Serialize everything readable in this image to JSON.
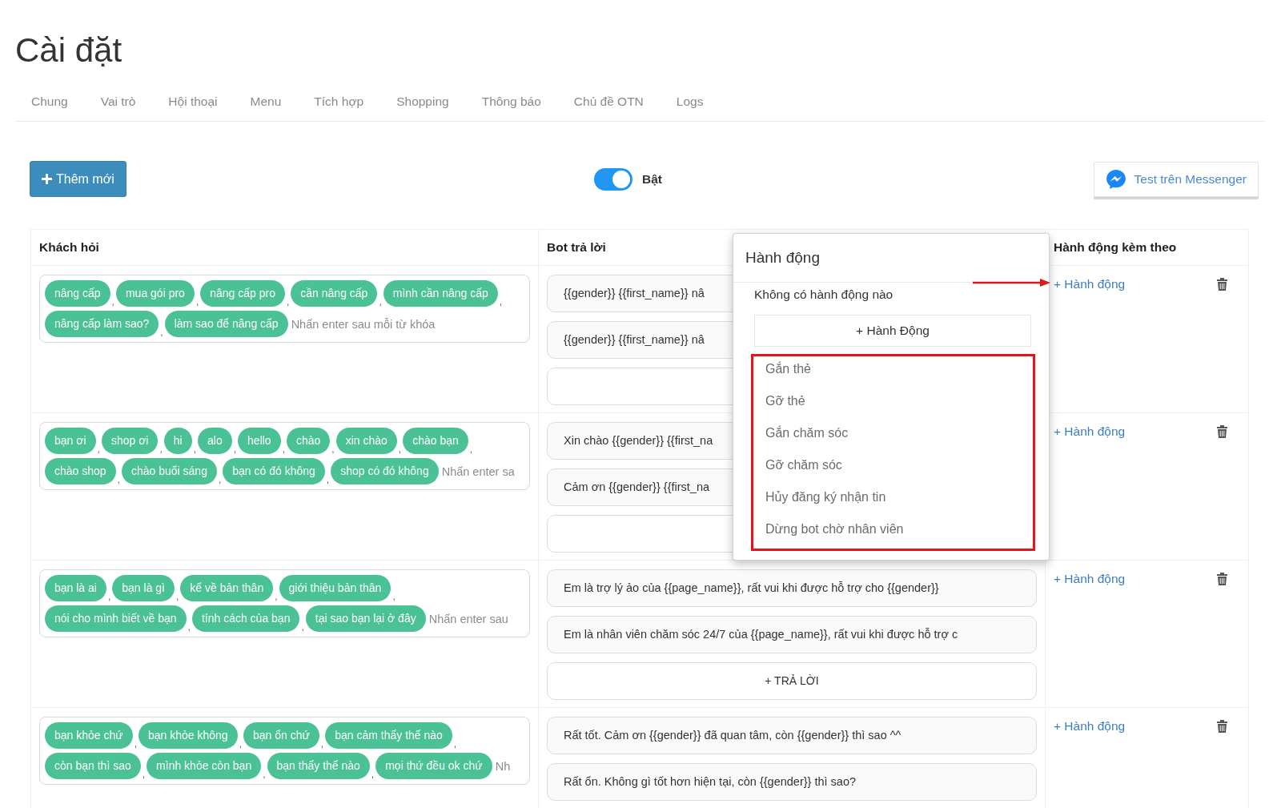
{
  "page": {
    "title": "Cài đặt"
  },
  "tabs": [
    {
      "label": "Chung",
      "selected": false
    },
    {
      "label": "Vai trò",
      "selected": false
    },
    {
      "label": "Hội thoại",
      "selected": false
    },
    {
      "label": "Menu",
      "selected": false
    },
    {
      "label": "Tích hợp",
      "selected": false
    },
    {
      "label": "Shopping",
      "selected": false
    },
    {
      "label": "Thông báo",
      "selected": false
    },
    {
      "label": "Chủ đề OTN",
      "selected": false
    },
    {
      "label": "Logs",
      "selected": false
    }
  ],
  "toolbar": {
    "add_button": "Thêm mới",
    "toggle": {
      "label": "Bật",
      "on": true
    },
    "test_button": "Test trên Messenger"
  },
  "table": {
    "columns": [
      "Khách hỏi",
      "Bot trả lời",
      "Hành động kèm theo"
    ],
    "rows": [
      {
        "keywords": [
          {
            "text": "nâng cấp",
            "separator": ","
          },
          {
            "text": "mua gói pro",
            "separator": ","
          },
          {
            "text": "nâng cấp pro",
            "separator": ","
          },
          {
            "text": "cần nâng cấp",
            "separator": ","
          },
          {
            "text": "mình cần nâng cấp",
            "separator": ","
          },
          {
            "text": "nâng cấp làm sao?",
            "separator": ","
          },
          {
            "text": "làm sao để nâng cấp"
          }
        ],
        "keyword_placeholder": "Nhấn enter sau mỗi từ khóa",
        "replies": [
          {
            "kind": "text",
            "text": "{{gender}} {{first_name}} nâ"
          },
          {
            "kind": "text",
            "text": "{{gender}} {{first_name}} nâ"
          },
          {
            "kind": "add"
          }
        ],
        "action_link": "+ Hành động"
      },
      {
        "keywords": [
          {
            "text": "bạn ơi",
            "separator": ","
          },
          {
            "text": "shop ơi",
            "separator": ","
          },
          {
            "text": "hi",
            "separator": ","
          },
          {
            "text": "alo",
            "separator": ","
          },
          {
            "text": "hello",
            "separator": ","
          },
          {
            "text": "chào",
            "separator": ","
          },
          {
            "text": "xin chào",
            "separator": ","
          },
          {
            "text": "chào bạn",
            "separator": ","
          },
          {
            "text": "chào shop",
            "separator": ","
          },
          {
            "text": "chào buổi sáng",
            "separator": ","
          },
          {
            "text": "bạn có đó không",
            "separator": ","
          },
          {
            "text": "shop có đó không"
          }
        ],
        "keyword_placeholder": "Nhấn enter sa",
        "replies": [
          {
            "kind": "text",
            "text": "Xin chào {{gender}} {{first_na"
          },
          {
            "kind": "text",
            "text": "Cảm ơn {{gender}} {{first_na"
          },
          {
            "kind": "add"
          }
        ],
        "action_link": "+ Hành động"
      },
      {
        "keywords": [
          {
            "text": "bạn là ai",
            "separator": ","
          },
          {
            "text": "bạn là gì",
            "separator": ","
          },
          {
            "text": "kể về bản thân",
            "separator": ","
          },
          {
            "text": "giới thiệu bản thân",
            "separator": ","
          },
          {
            "text": "nói cho mình biết về bạn",
            "separator": ","
          },
          {
            "text": "tính cách của bạn",
            "separator": ","
          },
          {
            "text": "tại sao bạn lại ở đây"
          }
        ],
        "keyword_placeholder": "Nhấn enter sau",
        "replies": [
          {
            "kind": "text",
            "text": "Em là trợ lý ảo của {{page_name}}, rất vui khi được hỗ trợ cho {{gender}}"
          },
          {
            "kind": "text",
            "text": "Em là nhân viên chăm sóc 24/7 của {{page_name}}, rất vui khi được hỗ trợ c"
          },
          {
            "kind": "add",
            "label": "+ TRẢ LỜI"
          }
        ],
        "action_link": "+ Hành động"
      },
      {
        "keywords": [
          {
            "text": "bạn khỏe chứ",
            "separator": ","
          },
          {
            "text": "bạn khỏe không",
            "separator": ","
          },
          {
            "text": "bạn ổn chứ",
            "separator": ","
          },
          {
            "text": "bạn cảm thấy thế nào",
            "separator": ","
          },
          {
            "text": "còn bạn thì sao",
            "separator": ","
          },
          {
            "text": "mình khỏe còn bạn",
            "separator": ","
          },
          {
            "text": "bạn thấy thế nào",
            "separator": ","
          },
          {
            "text": "mọi thứ đều ok chứ"
          }
        ],
        "keyword_placeholder": "Nh",
        "replies": [
          {
            "kind": "text",
            "text": "Rất tốt. Cảm ơn {{gender}} đã quan tâm, còn {{gender}} thì sao ^^"
          },
          {
            "kind": "text",
            "text": "Rất ổn. Không gì tốt hơn hiện tại, còn {{gender}} thì sao?"
          }
        ],
        "action_link": "+ Hành động"
      }
    ]
  },
  "actions_popup": {
    "title": "Hành động",
    "empty_text": "Không có hành động nào",
    "add_button": "+ Hành Động",
    "options": [
      "Gắn thẻ",
      "Gỡ thẻ",
      "Gắn chăm sóc",
      "Gỡ chăm sóc",
      "Hủy đăng ký nhận tin",
      "Dừng bot chờ nhân viên"
    ]
  }
}
